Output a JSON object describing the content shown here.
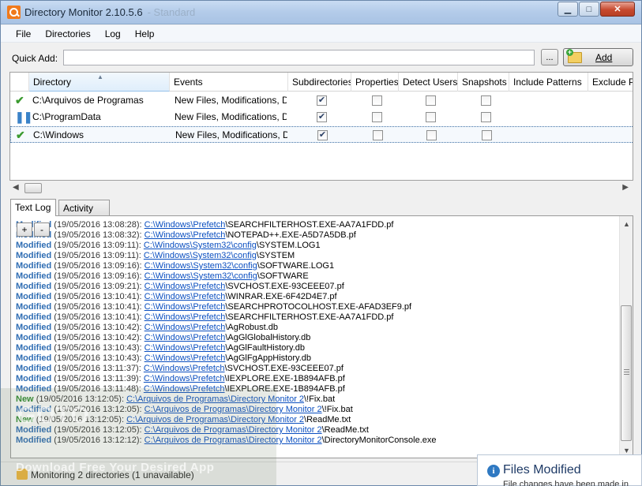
{
  "window": {
    "title": "Directory Monitor 2.10.5.6",
    "title_suffix": "- Standard"
  },
  "win_buttons": {
    "minimize": "▁",
    "maximize": "□",
    "close": "✕"
  },
  "menu": [
    "File",
    "Directories",
    "Log",
    "Help"
  ],
  "quick_add": {
    "label": "Quick Add:",
    "value": "",
    "placeholder": "",
    "browse_label": "...",
    "add_label": "Add"
  },
  "grid": {
    "columns": [
      "Directory",
      "Events",
      "Subdirectories",
      "Properties",
      "Detect Users",
      "Snapshots",
      "Include Patterns",
      "Exclude Patterns"
    ],
    "rows": [
      {
        "status": "active",
        "status_glyph": "✔",
        "directory": "C:\\Arquivos de Programas",
        "events": "New Files, Modifications, D...",
        "subdirectories": true,
        "properties": false,
        "detect_users": false,
        "snapshots": false
      },
      {
        "status": "paused",
        "status_glyph": "❚❚",
        "directory": "C:\\ProgramData",
        "events": "New Files, Modifications, D...",
        "subdirectories": true,
        "properties": false,
        "detect_users": false,
        "snapshots": false
      },
      {
        "status": "active",
        "status_glyph": "✔",
        "directory": "C:\\Windows",
        "events": "New Files, Modifications, D...",
        "subdirectories": true,
        "properties": false,
        "detect_users": false,
        "snapshots": false
      }
    ]
  },
  "tabs": [
    "Text Log",
    "Activity Log"
  ],
  "log_buttons": {
    "plus": "+",
    "minus": "-"
  },
  "log": [
    {
      "kind": "Modified",
      "time": "(19/05/2016  13:08:28):",
      "path": "C:\\Windows\\Prefetch",
      "file": "\\SEARCHFILTERHOST.EXE-AA7A1FDD.pf"
    },
    {
      "kind": "Modified",
      "time": "(19/05/2016  13:08:32):",
      "path": "C:\\Windows\\Prefetch",
      "file": "\\NOTEPAD++.EXE-A5D7A5DB.pf"
    },
    {
      "kind": "Modified",
      "time": "(19/05/2016  13:09:11):",
      "path": "C:\\Windows\\System32\\config",
      "file": "\\SYSTEM.LOG1"
    },
    {
      "kind": "Modified",
      "time": "(19/05/2016  13:09:11):",
      "path": "C:\\Windows\\System32\\config",
      "file": "\\SYSTEM"
    },
    {
      "kind": "Modified",
      "time": "(19/05/2016  13:09:16):",
      "path": "C:\\Windows\\System32\\config",
      "file": "\\SOFTWARE.LOG1"
    },
    {
      "kind": "Modified",
      "time": "(19/05/2016  13:09:16):",
      "path": "C:\\Windows\\System32\\config",
      "file": "\\SOFTWARE"
    },
    {
      "kind": "Modified",
      "time": "(19/05/2016  13:09:21):",
      "path": "C:\\Windows\\Prefetch",
      "file": "\\SVCHOST.EXE-93CEEE07.pf"
    },
    {
      "kind": "Modified",
      "time": "(19/05/2016  13:10:41):",
      "path": "C:\\Windows\\Prefetch",
      "file": "\\WINRAR.EXE-6F42D4E7.pf"
    },
    {
      "kind": "Modified",
      "time": "(19/05/2016  13:10:41):",
      "path": "C:\\Windows\\Prefetch",
      "file": "\\SEARCHPROTOCOLHOST.EXE-AFAD3EF9.pf"
    },
    {
      "kind": "Modified",
      "time": "(19/05/2016  13:10:41):",
      "path": "C:\\Windows\\Prefetch",
      "file": "\\SEARCHFILTERHOST.EXE-AA7A1FDD.pf"
    },
    {
      "kind": "Modified",
      "time": "(19/05/2016  13:10:42):",
      "path": "C:\\Windows\\Prefetch",
      "file": "\\AgRobust.db"
    },
    {
      "kind": "Modified",
      "time": "(19/05/2016  13:10:42):",
      "path": "C:\\Windows\\Prefetch",
      "file": "\\AgGlGlobalHistory.db"
    },
    {
      "kind": "Modified",
      "time": "(19/05/2016  13:10:43):",
      "path": "C:\\Windows\\Prefetch",
      "file": "\\AgGlFaultHistory.db"
    },
    {
      "kind": "Modified",
      "time": "(19/05/2016  13:10:43):",
      "path": "C:\\Windows\\Prefetch",
      "file": "\\AgGlFgAppHistory.db"
    },
    {
      "kind": "Modified",
      "time": "(19/05/2016  13:11:37):",
      "path": "C:\\Windows\\Prefetch",
      "file": "\\SVCHOST.EXE-93CEEE07.pf"
    },
    {
      "kind": "Modified",
      "time": "(19/05/2016  13:11:39):",
      "path": "C:\\Windows\\Prefetch",
      "file": "\\IEXPLORE.EXE-1B894AFB.pf"
    },
    {
      "kind": "Modified",
      "time": "(19/05/2016  13:11:48):",
      "path": "C:\\Windows\\Prefetch",
      "file": "\\IEXPLORE.EXE-1B894AFB.pf"
    },
    {
      "kind": "New",
      "time": "(19/05/2016  13:12:05):",
      "path": "C:\\Arquivos de Programas\\Directory Monitor 2",
      "file": "\\!Fix.bat"
    },
    {
      "kind": "Modified",
      "time": "(19/05/2016  13:12:05):",
      "path": "C:\\Arquivos de Programas\\Directory Monitor 2",
      "file": "\\!Fix.bat"
    },
    {
      "kind": "New",
      "time": "(19/05/2016  13:12:05):",
      "path": "C:\\Arquivos de Programas\\Directory Monitor 2",
      "file": "\\ReadMe.txt"
    },
    {
      "kind": "Modified",
      "time": "(19/05/2016  13:12:05):",
      "path": "C:\\Arquivos de Programas\\Directory Monitor 2",
      "file": "\\ReadMe.txt"
    },
    {
      "kind": "Modified",
      "time": "(19/05/2016  13:12:12):",
      "path": "C:\\Arquivos de Programas\\Directory Monitor 2",
      "file": "\\DirectoryMonitorConsole.exe"
    }
  ],
  "status": {
    "text": "Monitoring 2 directories (1 unavailable)"
  },
  "watermark": {
    "logo": "GOTO",
    "text": "Download Free Your Desired App"
  },
  "toast": {
    "icon": "i",
    "title": "Files Modified",
    "body": "File changes have been made in"
  }
}
